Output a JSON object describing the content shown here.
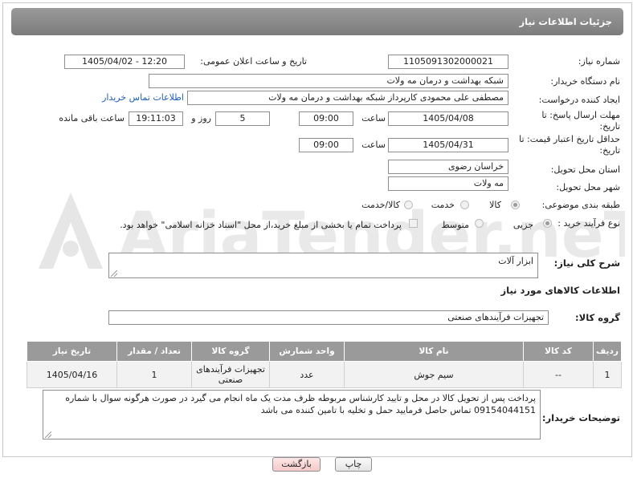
{
  "window": {
    "title": "جزئیات اطلاعات نیاز"
  },
  "labels": {
    "need_number": "شماره نیاز:",
    "announce_datetime": "تاریخ و ساعت اعلان عمومی:",
    "buyer_org": "نام دستگاه خریدار:",
    "creator": "ایجاد کننده درخواست:",
    "reply_deadline": "مهلت ارسال پاسخ: تا تاریخ:",
    "time_word": "ساعت",
    "day_and": "روز و",
    "remaining": "ساعت باقی مانده",
    "price_validity": "حداقل تاریخ اعتبار قیمت: تا تاریخ:",
    "province": "استان محل تحویل:",
    "city": "شهر محل تحویل:",
    "category": "طبقه بندی موضوعی:",
    "process_type": "نوع فرآیند خرید :",
    "need_description": "شرح کلی نیاز:",
    "goods_info": "اطلاعات کالاهای مورد نیاز",
    "goods_group": "گروه کالا:",
    "buyer_notes": "توضیحات خریدار:"
  },
  "fields": {
    "need_number": "1105091302000021",
    "announce_datetime": "1405/04/02 - 12:20",
    "buyer_org": "شبکه بهداشت و درمان مه ولات",
    "creator": "مصطفی علی محمودی کارپرداز شبکه بهداشت و درمان مه ولات",
    "contact_link": "اطلاعات تماس خریدار",
    "reply_date": "1405/04/08",
    "reply_time": "09:00",
    "days": "5",
    "remaining_time": "19:11:03",
    "validity_date": "1405/04/31",
    "validity_time": "09:00",
    "province": "خراسان رضوی",
    "city": "مه ولات",
    "need_description": "ابزار آلات",
    "goods_group": "تجهیزات فرآیندهای صنعتی",
    "buyer_notes": "پرداخت پس از تحویل کالا در محل و تایید کارشناس مربوطه ظرف مدت یک ماه انجام می گیرد در صورت هرگونه سوال با شماره 09154044151 تماس حاصل فرمایید حمل و تخلیه با تامین کننده می باشد"
  },
  "category_options": [
    {
      "label": "کالا",
      "selected": true
    },
    {
      "label": "خدمت",
      "selected": false
    },
    {
      "label": "کالا/خدمت",
      "selected": false
    }
  ],
  "process_options": [
    {
      "label": "جزیی",
      "selected": true
    },
    {
      "label": "متوسط",
      "selected": false
    }
  ],
  "payment_note": "پرداخت تمام یا بخشی از مبلغ خرید،از محل \"اسناد خزانه اسلامی\" خواهد بود.",
  "table": {
    "headers": [
      "ردیف",
      "کد کالا",
      "نام کالا",
      "واحد شمارش",
      "گروه کالا",
      "تعداد / مقدار",
      "تاریخ نیاز"
    ],
    "rows": [
      [
        "1",
        "--",
        "سیم جوش",
        "عدد",
        "تجهیزات فرآیندهای صنعتی",
        "1",
        "1405/04/16"
      ]
    ]
  },
  "buttons": {
    "print": "چاپ",
    "back": "بازگشت"
  },
  "watermark": "AriaTender.neT"
}
